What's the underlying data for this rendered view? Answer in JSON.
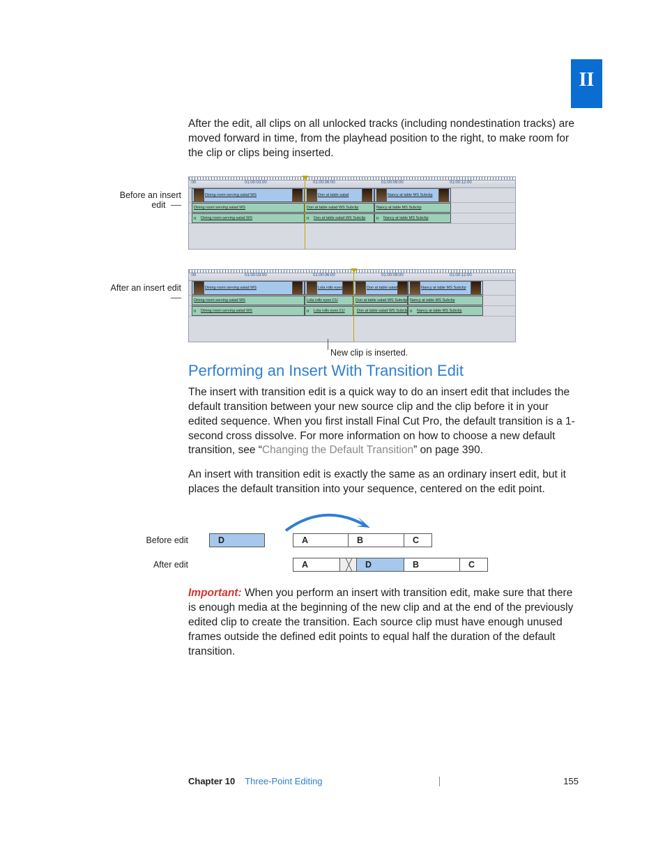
{
  "part_tab": "II",
  "intro_paragraph": "After the edit, all clips on all unlocked tracks (including nondestination tracks) are moved forward in time, from the playhead position to the right, to make room for the clip or clips being inserted.",
  "timeline_before": {
    "label": "Before an insert edit",
    "ruler": [
      ":00",
      "01:00:03:00",
      "01:00:06:00",
      "01:00:09:00",
      "01:00:12:00"
    ],
    "tracks": [
      {
        "type": "v",
        "clips": [
          "Dining room serving salad WS",
          "Don at table salad",
          "Nancy at table MS Subclip"
        ]
      },
      {
        "type": "a",
        "clips": [
          "Dining room serving salad WS",
          "Don at table salad WS Subclip",
          "Nancy at table MS Subclip"
        ]
      },
      {
        "type": "a",
        "clips": [
          "Dining room serving salad WS",
          "Don at table salad WS Subclip",
          "Nancy at table MS Subclip"
        ]
      }
    ]
  },
  "timeline_after": {
    "label": "After an insert edit",
    "ruler": [
      ":00",
      "01:00:03:00",
      "01:00:06:00",
      "01:00:09:00",
      "01:00:12:00"
    ],
    "tracks": [
      {
        "type": "v",
        "clips": [
          "Dining room serving salad WS",
          "Lola rolls eyes",
          "Don at table salad",
          "Nancy at table MS Subclip"
        ]
      },
      {
        "type": "a",
        "clips": [
          "Dining room serving salad WS",
          "Lola rolls eyes CU",
          "Don at table salad WS Subclip",
          "Nancy at table MS Subclip"
        ]
      },
      {
        "type": "a",
        "clips": [
          "Dining room serving salad WS",
          "Lola rolls eyes CU",
          "Don at table salad WS Subclip",
          "Nancy at table MS Subclip"
        ]
      }
    ],
    "annotation": "New clip is inserted."
  },
  "section_heading": "Performing an Insert With Transition Edit",
  "section_p1_a": "The insert with transition edit is a quick way to do an insert edit that includes the default transition between your new source clip and the clip before it in your edited sequence. When you first install Final Cut Pro, the default transition is a 1-second cross dissolve. For more information on how to choose a new default transition, see “",
  "section_p1_link": "Changing the Default Transition",
  "section_p1_b": "” on page 390.",
  "section_p2": "An insert with transition edit is exactly the same as an ordinary insert edit, but it places the default transition into your sequence, centered on the edit point.",
  "diagram": {
    "before_label": "Before edit",
    "after_label": "After edit",
    "before": [
      "D",
      "A",
      "B",
      "C"
    ],
    "after": [
      "A",
      "D",
      "B",
      "C"
    ]
  },
  "important_label": "Important:",
  "important_text": "  When you perform an insert with transition edit, make sure that there is enough media at the beginning of the new clip and at the end of the previously edited clip to create the transition. Each source clip must have enough unused frames outside the defined edit points to equal half the duration of the default transition.",
  "footer": {
    "chapter": "Chapter 10",
    "title": "Three-Point Editing",
    "page": "155"
  }
}
